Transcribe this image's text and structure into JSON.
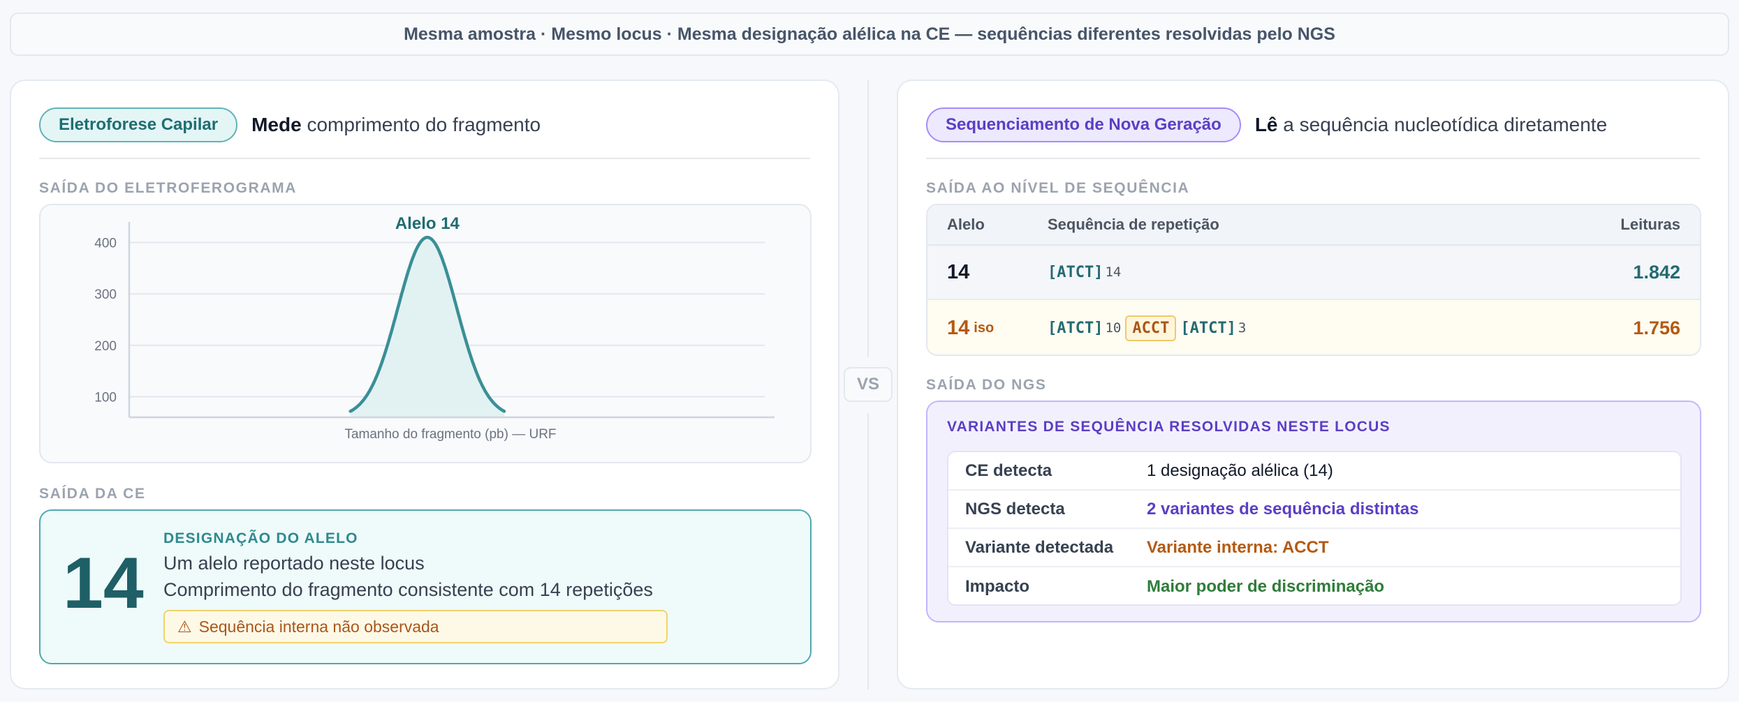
{
  "banner": "Mesma amostra · Mesmo locus · Mesma designação alélica na CE — sequências diferentes resolvidas pelo NGS",
  "left": {
    "pill": "Eletroforese Capilar",
    "desc_bold": "Mede",
    "desc_rest": " comprimento do fragmento",
    "chart_section": "SAÍDA DO ELETROFEROGRAMA",
    "ce_section": "SAÍDA DA CE",
    "ce_box": {
      "number": "14",
      "title": "DESIGNAÇÃO DO ALELO",
      "line1": "Um alelo reportado neste locus",
      "line2": "Comprimento do fragmento consistente com 14 repetições",
      "warning_icon": "⚠",
      "warning": "Sequência interna não observada"
    }
  },
  "chart_data": {
    "type": "area",
    "title": "",
    "xlabel": "Tamanho do fragmento (pb) — URF",
    "ylabel": "",
    "yticks": [
      "100",
      "300",
      "200",
      "400"
    ],
    "ytick_values": [
      100,
      300,
      200,
      400
    ],
    "ylim": [
      60,
      440
    ],
    "xlim": [
      0,
      100
    ],
    "grid": true,
    "peak": {
      "label": "Alelo 14",
      "x": 46.5,
      "height": 410,
      "baseline": 60,
      "sigma": 4.6,
      "x_start": 34.5,
      "x_end": 58.5
    },
    "colors": {
      "line": "#3b8f96",
      "fill": "#e2f2f3",
      "label": "#1f6b72"
    }
  },
  "vs": "VS",
  "right": {
    "pill": "Sequenciamento de Nova Geração",
    "desc_bold": "Lê",
    "desc_rest": " a sequência nucleotídica diretamente",
    "seq_section": "SAÍDA AO NÍVEL DE SEQUÊNCIA",
    "ngs_section": "SAÍDA DO NGS",
    "table": {
      "headers": {
        "allele": "Alelo",
        "seq": "Sequência de repetição",
        "reads": "Leituras"
      },
      "row1": {
        "allele": "14",
        "motif1": "[ATCT]",
        "count1": "14",
        "reads": "1.842"
      },
      "row2": {
        "allele": "14",
        "iso": "iso",
        "motif1": "[ATCT]",
        "count1": "10",
        "motif2": "ACCT",
        "motif3": "[ATCT]",
        "count3": "3",
        "reads": "1.756"
      }
    },
    "variants": {
      "title": "VARIANTES DE SEQUÊNCIA RESOLVIDAS NESTE LOCUS",
      "rows": [
        {
          "key": "CE detecta",
          "value": "1 designação alélica (14)",
          "color": "#111827"
        },
        {
          "key": "NGS detecta",
          "value": "2 variantes de sequência distintas",
          "color": "#5b3fc4"
        },
        {
          "key": "Variante detectada",
          "value": "Variante interna: ACCT",
          "color": "#b45a12"
        },
        {
          "key": "Impacto",
          "value": "Maior poder de discriminação",
          "color": "#2f7d3a"
        }
      ]
    }
  }
}
